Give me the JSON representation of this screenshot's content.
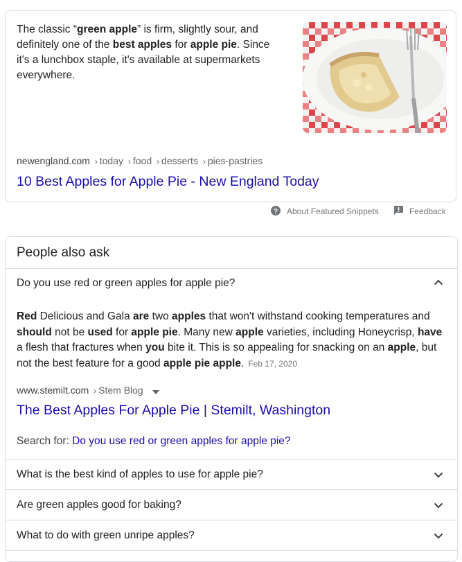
{
  "snippet": {
    "text_parts": [
      {
        "t": "The classic “",
        "b": false
      },
      {
        "t": "green apple",
        "b": true
      },
      {
        "t": "” is firm, slightly sour, and definitely one of the ",
        "b": false
      },
      {
        "t": "best apples",
        "b": true
      },
      {
        "t": " for ",
        "b": false
      },
      {
        "t": "apple pie",
        "b": true
      },
      {
        "t": ". Since it's a lunchbox staple, it's available at supermarkets everywhere.",
        "b": false
      }
    ],
    "image_icon": "apple-pie-slice-photo",
    "breadcrumb": {
      "domain": "newengland.com",
      "path": [
        "today",
        "food",
        "desserts",
        "pies-pastries"
      ]
    },
    "title": "10 Best Apples for Apple Pie - New England Today"
  },
  "meta": {
    "about_label": "About Featured Snippets",
    "feedback_label": "Feedback"
  },
  "paa": {
    "heading": "People also ask",
    "expanded": {
      "question": "Do you use red or green apples for apple pie?",
      "answer_parts": [
        {
          "t": "Red",
          "b": true
        },
        {
          "t": " Delicious and Gala ",
          "b": false
        },
        {
          "t": "are",
          "b": true
        },
        {
          "t": " two ",
          "b": false
        },
        {
          "t": "apples",
          "b": true
        },
        {
          "t": " that won't withstand cooking temperatures and ",
          "b": false
        },
        {
          "t": "should",
          "b": true
        },
        {
          "t": " not be ",
          "b": false
        },
        {
          "t": "used",
          "b": true
        },
        {
          "t": " for ",
          "b": false
        },
        {
          "t": "apple pie",
          "b": true
        },
        {
          "t": ". Many new ",
          "b": false
        },
        {
          "t": "apple",
          "b": true
        },
        {
          "t": " varieties, including Honeycrisp, ",
          "b": false
        },
        {
          "t": "have",
          "b": true
        },
        {
          "t": " a flesh that fractures when ",
          "b": false
        },
        {
          "t": "you",
          "b": true
        },
        {
          "t": " bite it. This is so appealing for snacking on an ",
          "b": false
        },
        {
          "t": "apple",
          "b": true
        },
        {
          "t": ", but not the best feature for a good ",
          "b": false
        },
        {
          "t": "apple pie apple",
          "b": true
        },
        {
          "t": ".",
          "b": false
        }
      ],
      "date": "Feb 17, 2020",
      "source_domain": "www.stemilt.com",
      "source_path": "Stem Blog",
      "title": "The Best Apples For Apple Pie | Stemilt, Washington",
      "search_for_label": "Search for:",
      "search_for_query": "Do you use red or green apples for apple pie?"
    },
    "questions": [
      "What is the best kind of apples to use for apple pie?",
      "Are green apples good for baking?",
      "What to do with green unripe apples?"
    ]
  },
  "colors": {
    "link": "#1a0dab",
    "text": "#202124",
    "muted": "#70757a",
    "border": "#dadce0"
  }
}
